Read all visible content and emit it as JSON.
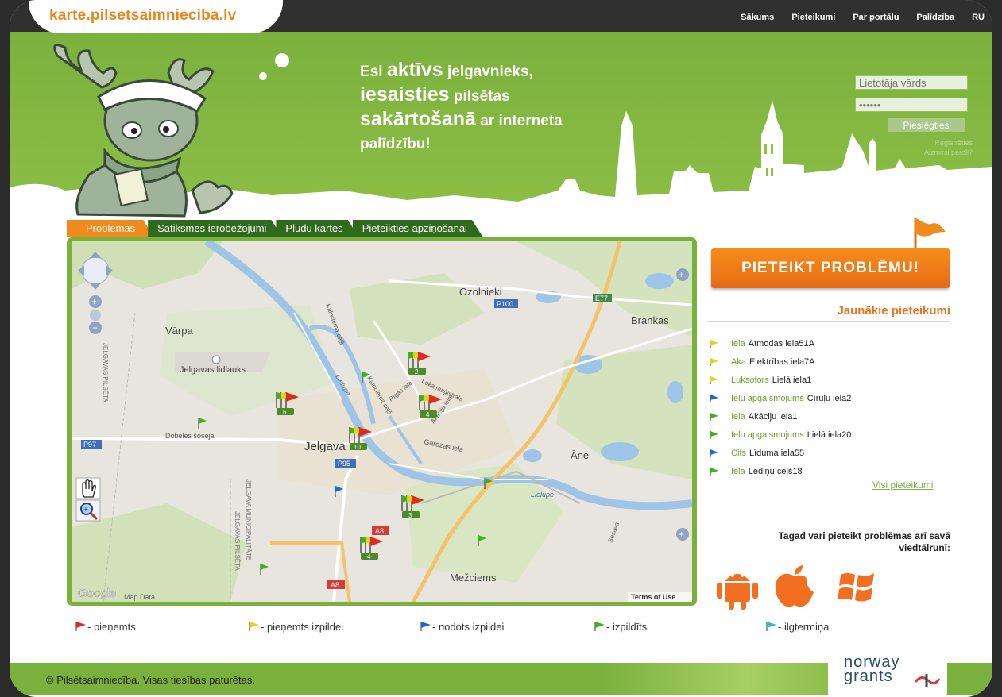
{
  "site": {
    "logo": "karte.pilsetsaimnieciba.lv"
  },
  "nav": [
    "Sākums",
    "Pieteikumi",
    "Par portālu",
    "Palīdzība",
    "RU"
  ],
  "hero": {
    "line1_a": "Esi ",
    "line1_b": "aktīvs",
    "line1_c": " jelgavnieks,",
    "line2_a": "iesaisties",
    "line2_b": " pilsētas",
    "line3_a": "sakārtošanā",
    "line3_b": " ar interneta",
    "line4": "palīdzību!"
  },
  "login": {
    "username_placeholder": "Lietotāja vārds",
    "password_value": "••••••",
    "login_button": "Pieslēgties",
    "register": "Reģistrēties",
    "forgot": "Aizmirsi paroli?"
  },
  "tabs": [
    "Problēmas",
    "Satiksmes ierobežojumi",
    "Plūdu kartes",
    "Pieteikties apziņošanai"
  ],
  "map": {
    "labels": {
      "ozolnieki": "Ozolnieki",
      "brankas": "Brankas",
      "varpa": "Vārpa",
      "airport": "Jelgavas lidlauks",
      "jelgava": "Jelgava",
      "ane": "Āne",
      "mezciems": "Mežciems",
      "dobeles": "Dobeles šoseja",
      "garozas": "Garozas iela",
      "lielupe1": "Lielupe",
      "lielupe2": "Lielupe",
      "sesava": "Sesava",
      "kalnciema1": "Kalnciema ceļš",
      "kalnciema2": "Kalnciema ceļš",
      "rigas": "Rīgas iela",
      "loka": "Loka maģistrāle",
      "akaciju": "Akāciju iela",
      "jelgavas_pilseta1": "JELGAVAS PILSĒTA",
      "jelgavas_pilseta2": "JELGAVAS PILSĒTA",
      "jelgava_municipal": "JELGAVA MUNICIPALITĀTE",
      "google": "Google",
      "mapdata": "Map Data",
      "terms": "Terms of Use"
    },
    "roads": {
      "p100": "P100",
      "e77": "E77",
      "p97": "P97",
      "p95": "P95",
      "a8a": "A8",
      "a8b": "A8"
    },
    "clusters": [
      "2",
      "4",
      "6",
      "10",
      "3",
      "4"
    ]
  },
  "legend": [
    {
      "label": "- pieņemts",
      "color": "#e02a1a"
    },
    {
      "label": "- pieņemts izpildei",
      "color": "#e6d21a"
    },
    {
      "label": "- nodots izpildei",
      "color": "#1a6ad0"
    },
    {
      "label": "- izpildīts",
      "color": "#3db21a"
    },
    {
      "label": "- ilgtermiņa",
      "color": "#2ec4b0"
    }
  ],
  "report_button": "PIETEIKT PROBLĒMU!",
  "recent": {
    "title": "Jaunākie pieteikumi",
    "items": [
      {
        "cat": "Iela",
        "addr": "Atmodas iela51A",
        "color": "#e6d21a"
      },
      {
        "cat": "Aka",
        "addr": "Elektrības iela7A",
        "color": "#e6d21a"
      },
      {
        "cat": "Luksofors",
        "addr": "Lielā iela1",
        "color": "#e6d21a"
      },
      {
        "cat": "Ielu apgaismojums",
        "addr": "Cīruļu iela2",
        "color": "#1a6ad0"
      },
      {
        "cat": "Iela",
        "addr": "Akāciju iela1",
        "color": "#3db21a"
      },
      {
        "cat": "Ielu apgaismojums",
        "addr": "Lielā iela20",
        "color": "#3db21a"
      },
      {
        "cat": "Cits",
        "addr": "Līduma iela55",
        "color": "#1a6ad0"
      },
      {
        "cat": "Iela",
        "addr": "Lediņu ceļš18",
        "color": "#3db21a"
      }
    ],
    "all": "Visi pieteikumi"
  },
  "mobile": {
    "line1": "Tagad vari pieteikt problēmas arī savā",
    "line2": "viedtālrunī:"
  },
  "footer": {
    "copyright": "© Pilsētsaimniecība. Visas tiesības paturētas.",
    "norway1": "norway",
    "norway2": "grants"
  }
}
